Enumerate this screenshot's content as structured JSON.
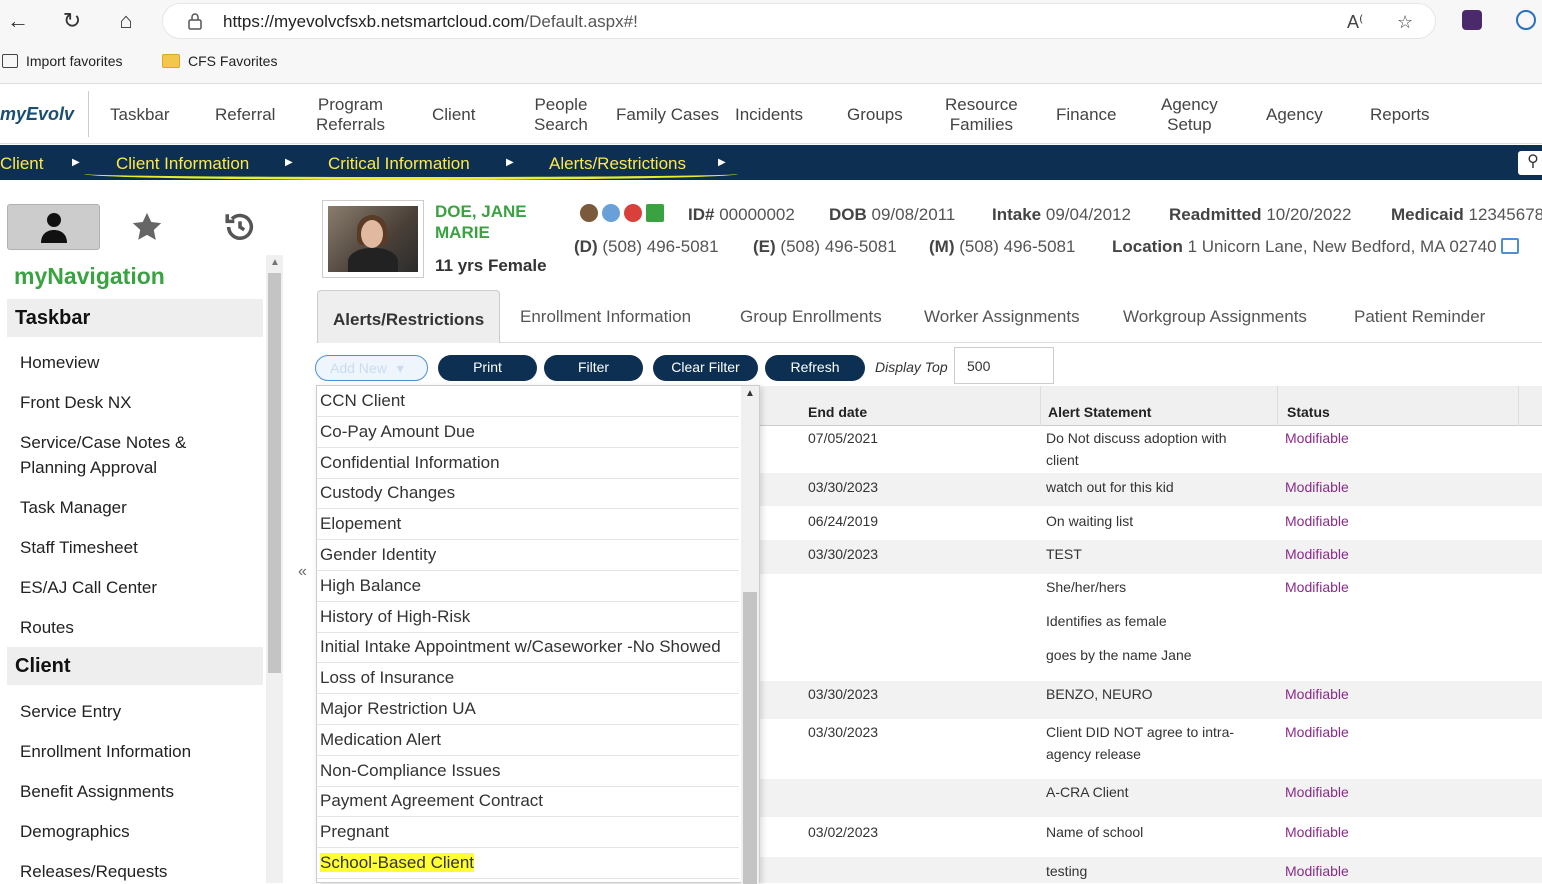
{
  "browser": {
    "url_host": "https://myevolvcfsxb.netsmartcloud.com",
    "url_path": "/Default.aspx#!",
    "favorites": [
      "Import favorites",
      "CFS Favorites"
    ]
  },
  "app": {
    "brand": "myEvolv",
    "nav": [
      {
        "l1": "Taskbar",
        "l2": ""
      },
      {
        "l1": "Referral",
        "l2": ""
      },
      {
        "l1": "Program",
        "l2": "Referrals"
      },
      {
        "l1": "Client",
        "l2": ""
      },
      {
        "l1": "People",
        "l2": "Search"
      },
      {
        "l1": "Family Cases",
        "l2": ""
      },
      {
        "l1": "Incidents",
        "l2": ""
      },
      {
        "l1": "Groups",
        "l2": ""
      },
      {
        "l1": "Resource",
        "l2": "Families"
      },
      {
        "l1": "Finance",
        "l2": ""
      },
      {
        "l1": "Agency",
        "l2": "Setup"
      },
      {
        "l1": "Agency",
        "l2": ""
      },
      {
        "l1": "Reports",
        "l2": ""
      }
    ],
    "breadcrumb": [
      "Client",
      "Client Information",
      "Critical Information",
      "Alerts/Restrictions"
    ]
  },
  "sidebar": {
    "title": "myNavigation",
    "sections": [
      {
        "name": "Taskbar",
        "items": [
          "Homeview",
          "Front Desk NX",
          "Service/Case Notes &",
          "Planning Approval",
          "Task Manager",
          "Staff Timesheet",
          "ES/AJ Call Center",
          "Routes"
        ]
      },
      {
        "name": "Client",
        "items": [
          "Service Entry",
          "Enrollment Information",
          "Benefit Assignments",
          "Demographics",
          "Releases/Requests"
        ]
      }
    ]
  },
  "client": {
    "name_line1": "DOE, JANE",
    "name_line2": "MARIE",
    "age": "11 yrs Female",
    "id_label": "ID#",
    "id": "00000002",
    "dob_label": "DOB",
    "dob": "09/08/2011",
    "intake_label": "Intake",
    "intake": "09/04/2012",
    "readmitted_label": "Readmitted",
    "readmitted": "10/20/2022",
    "medicaid_label": "Medicaid",
    "medicaid": "12345678",
    "d_label": "(D)",
    "d_phone": "(508) 496-5081",
    "e_label": "(E)",
    "e_phone": "(508) 496-5081",
    "m_label": "(M)",
    "m_phone": "(508) 496-5081",
    "location_label": "Location",
    "location": "1 Unicorn Lane, New Bedford, MA 02740"
  },
  "tabs": [
    "Alerts/Restrictions",
    "Enrollment Information",
    "Group Enrollments",
    "Worker Assignments",
    "Workgroup Assignments",
    "Patient Reminder"
  ],
  "toolbar": {
    "add_new": "Add New",
    "print": "Print",
    "filter": "Filter",
    "clear_filter": "Clear Filter",
    "refresh": "Refresh",
    "display_top_label": "Display Top",
    "display_top_value": "500"
  },
  "grid": {
    "headers": [
      "End date",
      "Alert Statement",
      "Status"
    ],
    "rows": [
      {
        "end": "07/05/2021",
        "alert1": "Do Not discuss adoption with",
        "alert2": "client",
        "status": "Modifiable"
      },
      {
        "end": "03/30/2023",
        "alert1": "watch out for this kid",
        "alert2": "",
        "status": "Modifiable"
      },
      {
        "end": "06/24/2019",
        "alert1": "On waiting list",
        "alert2": "",
        "status": "Modifiable"
      },
      {
        "end": "03/30/2023",
        "alert1": "TEST",
        "alert2": "",
        "status": "Modifiable"
      },
      {
        "end": "",
        "alert1": "She/her/hers",
        "alert2": "",
        "status": "Modifiable"
      },
      {
        "end": "",
        "alert1": "Identifies as female",
        "alert2": "",
        "status": ""
      },
      {
        "end": "",
        "alert1": "goes by the name Jane",
        "alert2": "",
        "status": ""
      },
      {
        "end": "03/30/2023",
        "alert1": "BENZO, NEURO",
        "alert2": "",
        "status": "Modifiable"
      },
      {
        "end": "03/30/2023",
        "alert1": "Client DID NOT agree to intra-",
        "alert2": "agency release",
        "status": "Modifiable"
      },
      {
        "end": "",
        "alert1": "A-CRA Client",
        "alert2": "",
        "status": "Modifiable"
      },
      {
        "end": "03/02/2023",
        "alert1": "Name of school",
        "alert2": "",
        "status": "Modifiable"
      },
      {
        "end": "",
        "alert1": "testing",
        "alert2": "",
        "status": "Modifiable"
      }
    ]
  },
  "dropdown": {
    "items": [
      "CCN Client",
      "Co-Pay Amount Due",
      "Confidential Information",
      "Custody Changes",
      "Elopement",
      "Gender Identity",
      "High Balance",
      "History of High-Risk",
      "Initial Intake Appointment w/Caseworker -No Showed",
      "Loss of Insurance",
      "Major Restriction UA",
      "Medication Alert",
      "Non-Compliance Issues",
      "Payment Agreement Contract",
      "Pregnant",
      "School-Based Client"
    ]
  },
  "colors": {
    "navy": "#0c2f52",
    "breadcrumb_text": "#ffe74c",
    "brand_green": "#3aa241",
    "status_purple": "#8a2b8a",
    "highlight": "#ffff33"
  }
}
